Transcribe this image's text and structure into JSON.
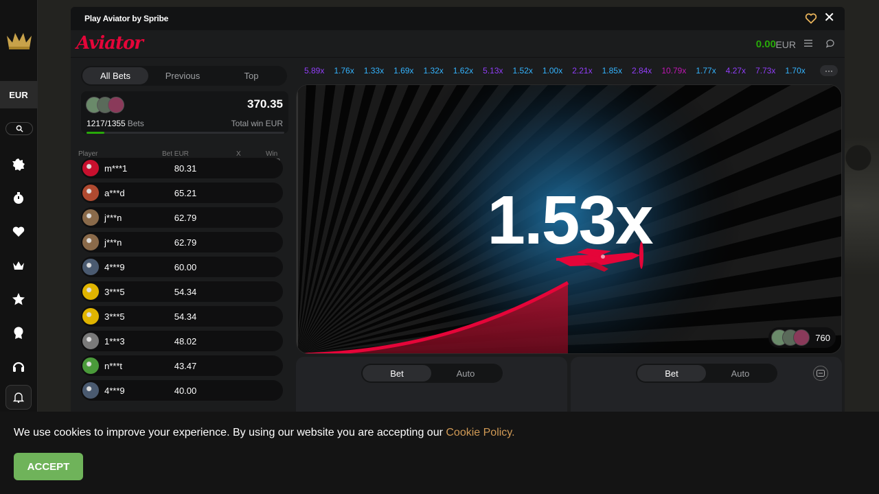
{
  "colors": {
    "accent_red": "#e50539",
    "balance_green": "#28a909",
    "accept_green": "#6fb35a",
    "cookie_link": "#d19a55"
  },
  "sidebar": {
    "currency": "EUR",
    "items": [
      {
        "icon": "new-badge-icon"
      },
      {
        "icon": "stopwatch-icon"
      },
      {
        "icon": "heart-icon"
      },
      {
        "icon": "crown-icon"
      },
      {
        "icon": "star-icon"
      },
      {
        "icon": "award-icon"
      },
      {
        "icon": "headset-icon"
      },
      {
        "icon": "bell-icon"
      }
    ]
  },
  "window": {
    "title": "Play Aviator by Spribe",
    "logo": "Aviator",
    "balance": "0.00",
    "balance_currency": "EUR"
  },
  "bets_panel": {
    "tabs": [
      "All Bets",
      "Previous",
      "Top"
    ],
    "active_tab": "All Bets",
    "count": "1217/1355",
    "count_label": "Bets",
    "total_win": "370.35",
    "total_win_label": "Total win EUR",
    "progress": 0.09,
    "columns": [
      "Player",
      "Bet EUR",
      "X",
      "Win EUR"
    ],
    "rows": [
      {
        "player": "m***1",
        "bet": "80.31",
        "avatar_color": "#c8102e"
      },
      {
        "player": "a***d",
        "bet": "65.21",
        "avatar_color": "#b04a30"
      },
      {
        "player": "j***n",
        "bet": "62.79",
        "avatar_color": "#8a6a4a"
      },
      {
        "player": "j***n",
        "bet": "62.79",
        "avatar_color": "#8a6a4a"
      },
      {
        "player": "4***9",
        "bet": "60.00",
        "avatar_color": "#4a5a70"
      },
      {
        "player": "3***5",
        "bet": "54.34",
        "avatar_color": "#e0b400"
      },
      {
        "player": "3***5",
        "bet": "54.34",
        "avatar_color": "#e0b400"
      },
      {
        "player": "1***3",
        "bet": "48.02",
        "avatar_color": "#7a7a7a"
      },
      {
        "player": "n***t",
        "bet": "43.47",
        "avatar_color": "#4a9a3a"
      },
      {
        "player": "4***9",
        "bet": "40.00",
        "avatar_color": "#4a5a70"
      }
    ]
  },
  "history": [
    {
      "v": "5.89x",
      "c": "#913ef8"
    },
    {
      "v": "1.76x",
      "c": "#34b4ff"
    },
    {
      "v": "1.33x",
      "c": "#34b4ff"
    },
    {
      "v": "1.69x",
      "c": "#34b4ff"
    },
    {
      "v": "1.32x",
      "c": "#34b4ff"
    },
    {
      "v": "1.62x",
      "c": "#34b4ff"
    },
    {
      "v": "5.13x",
      "c": "#913ef8"
    },
    {
      "v": "1.52x",
      "c": "#34b4ff"
    },
    {
      "v": "1.00x",
      "c": "#34b4ff"
    },
    {
      "v": "2.21x",
      "c": "#913ef8"
    },
    {
      "v": "1.85x",
      "c": "#34b4ff"
    },
    {
      "v": "2.84x",
      "c": "#913ef8"
    },
    {
      "v": "10.79x",
      "c": "#c017b4"
    },
    {
      "v": "1.77x",
      "c": "#34b4ff"
    },
    {
      "v": "4.27x",
      "c": "#913ef8"
    },
    {
      "v": "7.73x",
      "c": "#913ef8"
    },
    {
      "v": "1.70x",
      "c": "#34b4ff"
    }
  ],
  "history_more": "···",
  "game": {
    "multiplier": "1.53x",
    "players_online": "760"
  },
  "bet_controls": [
    {
      "tabs": [
        "Bet",
        "Auto"
      ],
      "active": "Bet"
    },
    {
      "tabs": [
        "Bet",
        "Auto"
      ],
      "active": "Bet"
    }
  ],
  "cookie": {
    "message": "We use cookies to improve your experience. By using our website you are accepting our",
    "link": "Cookie Policy.",
    "accept": "ACCEPT"
  }
}
